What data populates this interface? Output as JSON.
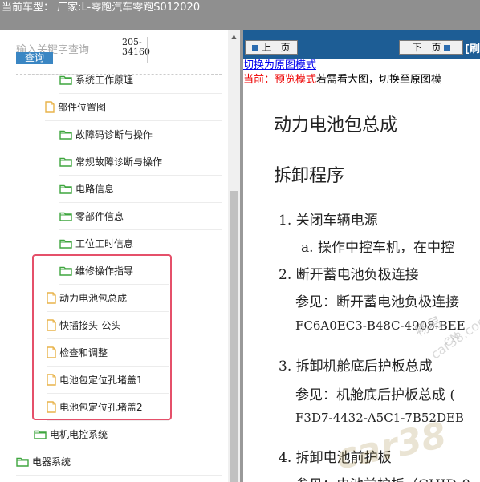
{
  "window": {
    "title": "当前车型： 厂家:L-零跑汽车零跑S012020"
  },
  "search": {
    "placeholder": "输入关键字查询",
    "button_label": "查询",
    "code_line1": "205-",
    "code_line2": "34160"
  },
  "tree": {
    "items": [
      {
        "label": "系统工作原理",
        "icon": "folder-icon"
      },
      {
        "label": "部件位置图",
        "icon": "document-icon"
      },
      {
        "label": "故障码诊断与操作",
        "icon": "folder-icon"
      },
      {
        "label": "常规故障诊断与操作",
        "icon": "folder-icon"
      },
      {
        "label": "电路信息",
        "icon": "folder-icon"
      },
      {
        "label": "零部件信息",
        "icon": "folder-icon"
      },
      {
        "label": "工位工时信息",
        "icon": "folder-icon"
      },
      {
        "label": "维修操作指导",
        "icon": "folder-icon"
      },
      {
        "label": "动力电池包总成",
        "icon": "document-icon"
      },
      {
        "label": "快插接头-公头",
        "icon": "document-icon"
      },
      {
        "label": "检查和调整",
        "icon": "document-icon"
      },
      {
        "label": "电池包定位孔堵盖1",
        "icon": "document-icon"
      },
      {
        "label": "电池包定位孔堵盖2",
        "icon": "document-icon"
      },
      {
        "label": "电机电控系统",
        "icon": "folder-icon"
      },
      {
        "label": "电器系统",
        "icon": "folder-icon"
      }
    ]
  },
  "nav": {
    "prev_label": "上一页",
    "next_label": "下一页",
    "refresh_label": "[刷"
  },
  "mode": {
    "switch_link": "切换为原图模式",
    "current_prefix": "当前：预览模式",
    "current_suffix": "若需看大图，切换至原图模"
  },
  "document": {
    "title": "动力电池包总成",
    "section": "拆卸程序",
    "step1": "1. 关闭车辆电源",
    "step1a": "a. 操作中控车机，在中控",
    "step2": "2. 断开蓄电池负极连接",
    "step2_ref": "参见：断开蓄电池负极连接",
    "step2_code": "FC6A0EC3-B48C-4908-BEE",
    "step3": "3. 拆卸机舱底后护板总成",
    "step3_ref": "参见：机舱底后护板总成 (",
    "step3_code": "F3D7-4432-A5C1-7B52DEB",
    "step4": "4. 拆卸电池前护板",
    "step4_ref": "参见：电池前护板（CHID-0"
  },
  "watermark": {
    "brand": "car38",
    "brand_cn": "畅易",
    "url": "car38.com",
    "code": "CN"
  },
  "colors": {
    "titlebar": "#8f8f8f",
    "navbar": "#1d5d95",
    "highlight_box": "#e5506a",
    "search_button": "#3a86c3",
    "folder_icon": "#3fa63f",
    "document_icon": "#e8b34a"
  }
}
